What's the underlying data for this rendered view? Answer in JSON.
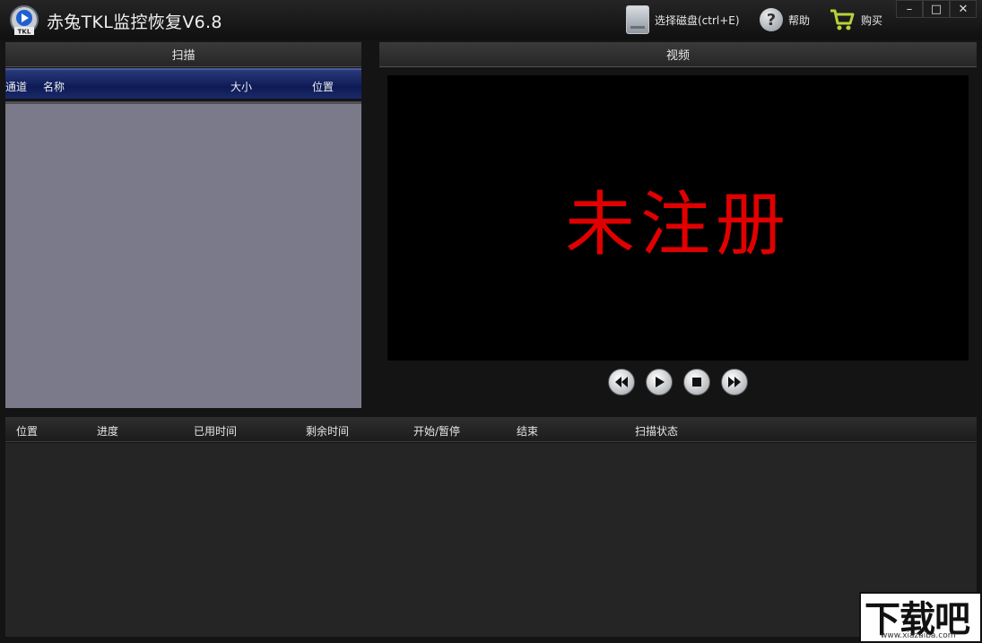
{
  "app": {
    "title": "赤兔TKL监控恢复V6.8",
    "logo_text": "TKL"
  },
  "toolbar": {
    "select_disk": "选择磁盘(ctrl+E)",
    "help": "帮助",
    "buy": "购买"
  },
  "window_controls": {
    "minimize": "–",
    "maximize": "□",
    "close": "✕"
  },
  "scan_panel": {
    "title": "扫描",
    "columns": [
      "通道",
      "名称",
      "大小",
      "位置"
    ]
  },
  "video_panel": {
    "title": "视频",
    "overlay_text": "未注册"
  },
  "player_controls": [
    {
      "name": "rewind-button",
      "icon": "rewind-icon"
    },
    {
      "name": "play-button",
      "icon": "play-icon"
    },
    {
      "name": "stop-button",
      "icon": "stop-icon"
    },
    {
      "name": "fast-forward-button",
      "icon": "fast-forward-icon"
    }
  ],
  "task_table": {
    "columns": [
      "位置",
      "进度",
      "已用时间",
      "剩余时间",
      "开始/暂停",
      "结束",
      "扫描状态"
    ]
  },
  "watermark": {
    "main": "下载吧",
    "sub": "www.xiazaiba.com"
  },
  "colors": {
    "unregistered_text": "#e00000",
    "scan_header": "#0d1a55",
    "scan_body": "#7a7a8a"
  }
}
